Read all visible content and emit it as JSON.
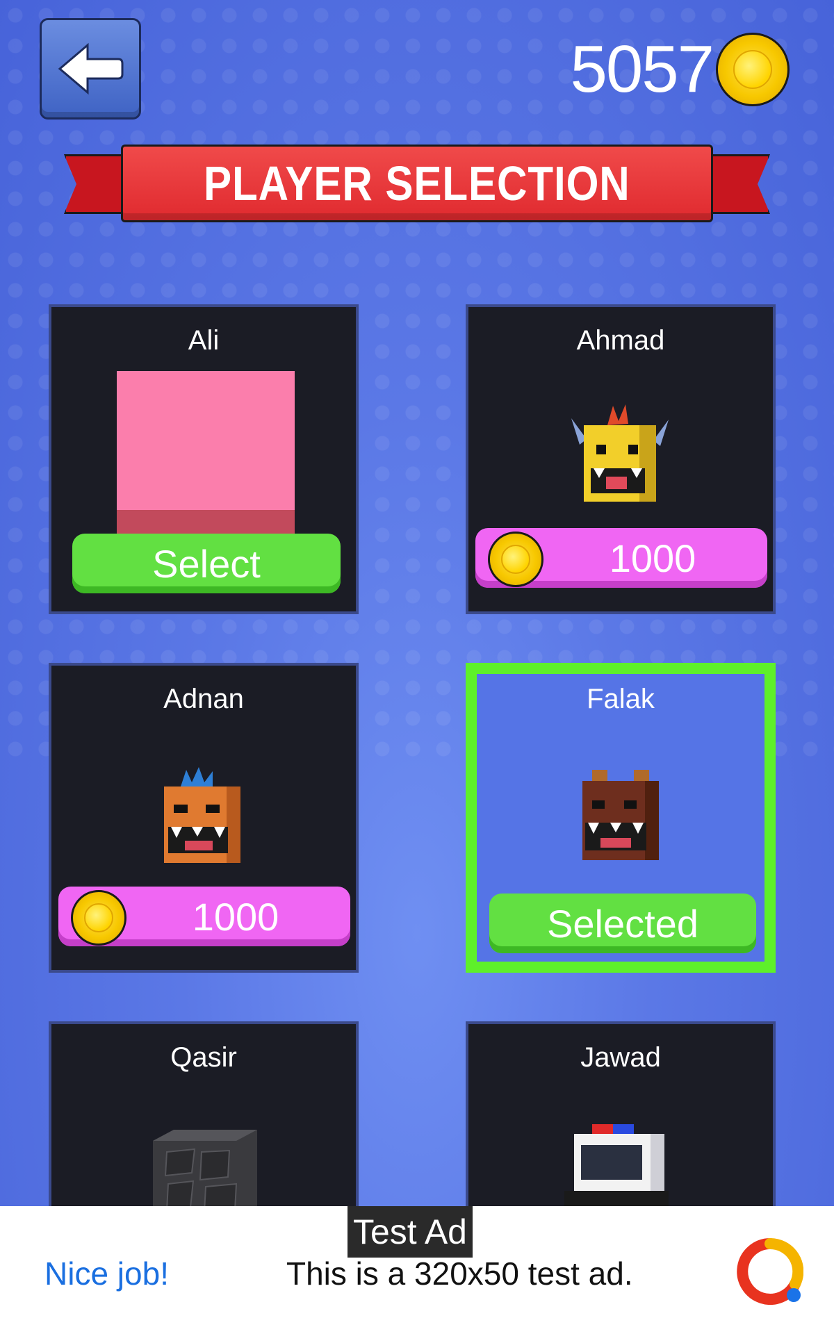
{
  "header": {
    "back_icon": "arrow-left-icon",
    "coin_balance": "5057",
    "coin_icon": "gold-coin-icon"
  },
  "banner": {
    "title": "PLAYER SELECTION"
  },
  "players": [
    {
      "name": "Ali",
      "action": "Select",
      "state": "owned",
      "avatar": "pink-cube"
    },
    {
      "name": "Ahmad",
      "action": "1000",
      "state": "locked",
      "avatar": "yellow-monster-head"
    },
    {
      "name": "Adnan",
      "action": "1000",
      "state": "locked",
      "avatar": "orange-dino-head"
    },
    {
      "name": "Falak",
      "action": "Selected",
      "state": "selected",
      "avatar": "brown-bear-head"
    },
    {
      "name": "Qasir",
      "action": "",
      "state": "partially-visible",
      "avatar": "stone-cube"
    },
    {
      "name": "Jawad",
      "action": "",
      "state": "partially-visible",
      "avatar": "police-car"
    }
  ],
  "ad": {
    "tag": "Test Ad",
    "left_text": "Nice job!",
    "body": "This is a 320x50 test ad.",
    "logo_icon": "ad-network-logo-icon"
  },
  "colors": {
    "select_green": "#62e042",
    "price_pink": "#f066f3",
    "selected_border": "#5ef02a",
    "banner_red": "#e02a2f",
    "card_bg": "#1b1c25"
  }
}
